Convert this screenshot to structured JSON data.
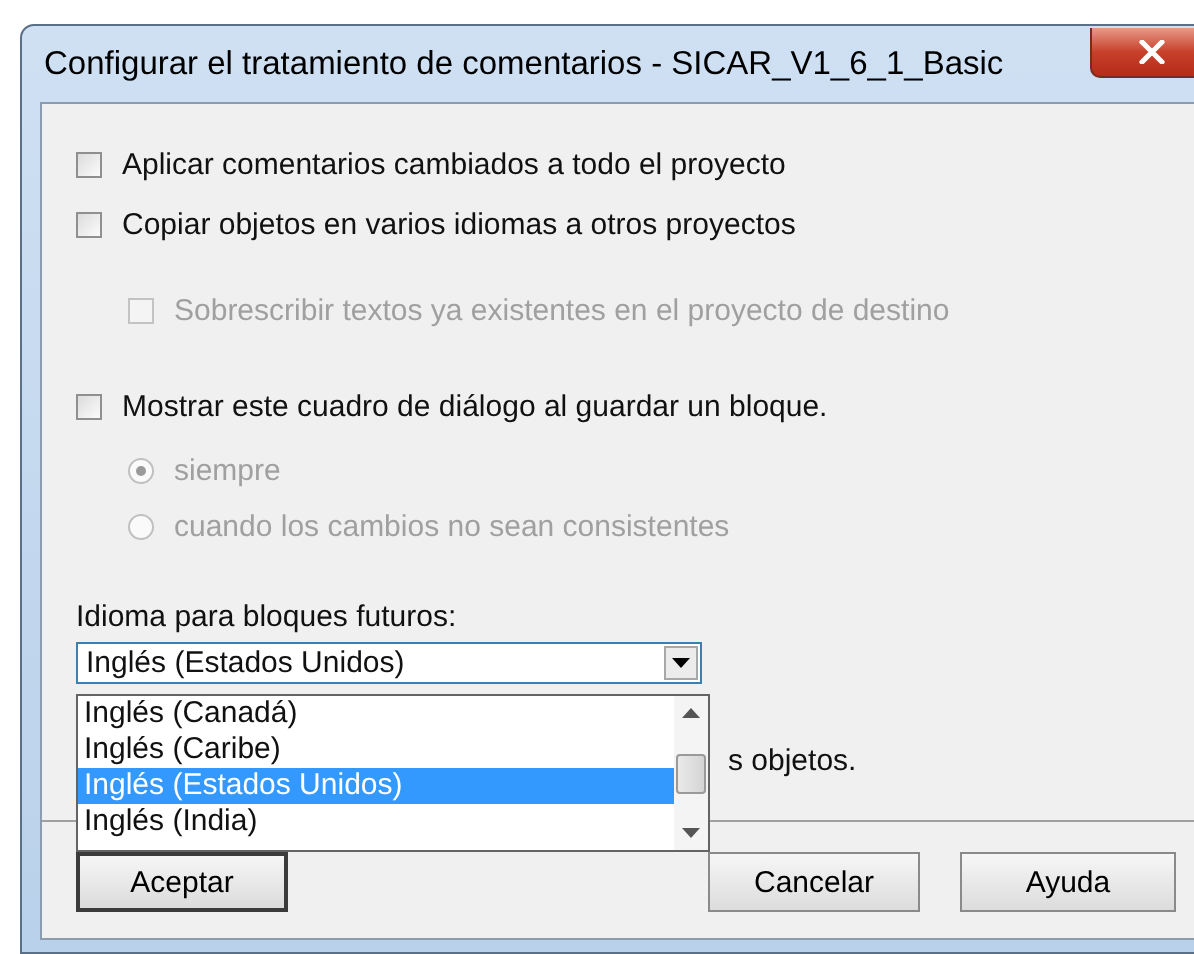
{
  "window": {
    "title": "Configurar el tratamiento de comentarios - SICAR_V1_6_1_Basic"
  },
  "options": [
    {
      "kind": "checkbox",
      "label": "Aplicar comentarios cambiados a todo el proyecto",
      "checked": false,
      "disabled": false
    },
    {
      "kind": "checkbox",
      "label": "Copiar objetos en varios idiomas a otros proyectos",
      "checked": false,
      "disabled": false,
      "children": [
        {
          "kind": "checkbox",
          "label": "Sobrescribir textos ya existentes en el proyecto de destino",
          "checked": false,
          "disabled": true
        }
      ]
    },
    {
      "kind": "checkbox",
      "label": "Mostrar este cuadro de diálogo al guardar un bloque.",
      "checked": false,
      "disabled": false,
      "children": [
        {
          "kind": "radio",
          "label": "siempre",
          "selected": true,
          "disabled": true
        },
        {
          "kind": "radio",
          "label": "cuando los cambios no sean consistentes",
          "selected": false,
          "disabled": true
        }
      ]
    }
  ],
  "language": {
    "label": "Idioma para bloques futuros:",
    "value": "Inglés (Estados Unidos)",
    "expanded": true,
    "options": [
      {
        "label": "Inglés (Canadá)",
        "selected": false
      },
      {
        "label": "Inglés (Caribe)",
        "selected": false
      },
      {
        "label": "Inglés (Estados Unidos)",
        "selected": true
      },
      {
        "label": "Inglés (India)",
        "selected": false
      }
    ]
  },
  "partly_hidden_text": "s objetos.",
  "buttons": [
    {
      "label": "Aceptar",
      "focused": true
    },
    {
      "label": "Cancelar",
      "focused": false
    },
    {
      "label": "Ayuda",
      "focused": false
    }
  ]
}
